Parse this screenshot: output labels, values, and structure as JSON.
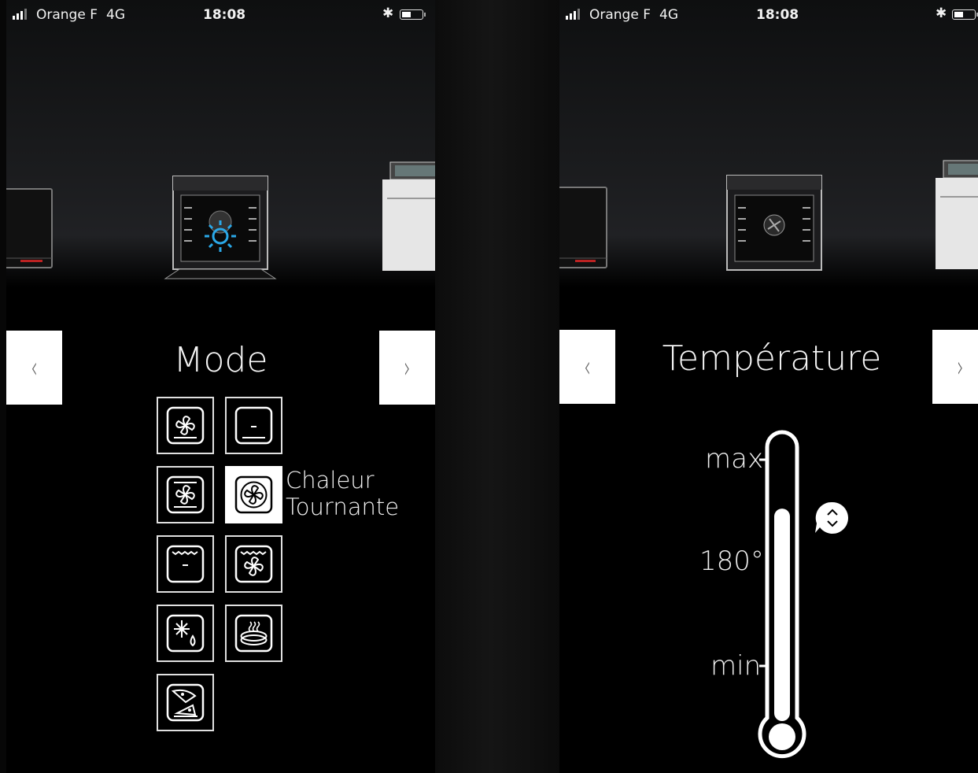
{
  "status_bar": {
    "carrier": "Orange F",
    "network": "4G",
    "time": "18:08"
  },
  "left_screen": {
    "heading": "Mode",
    "prev_button": "‹",
    "next_button": "›",
    "selected_mode": {
      "label_line1": "Chaleur",
      "label_line2": "Tournante"
    },
    "modes": [
      {
        "icon": "fan-bottom-heat-icon"
      },
      {
        "icon": "bottom-heat-icon"
      },
      {
        "icon": "fan-grill-icon"
      },
      {
        "icon": "hot-air-fan-icon",
        "selected": true
      },
      {
        "icon": "top-bottom-heat-icon"
      },
      {
        "icon": "grill-fan-icon"
      },
      {
        "icon": "defrost-icon"
      },
      {
        "icon": "plate-warming-icon"
      },
      {
        "icon": "pizza-icon"
      }
    ]
  },
  "right_screen": {
    "heading": "Température",
    "prev_button": "‹",
    "next_button": "›",
    "thermometer": {
      "max_label": "max",
      "value_label": "180°",
      "min_label": "min",
      "fill_fraction": 0.78
    },
    "adjust_icon": "up-down-chevron-icon"
  },
  "colors": {
    "accent_blue": "#2aa8e8",
    "background": "#000000",
    "tile_border": "#e0e0e0"
  }
}
